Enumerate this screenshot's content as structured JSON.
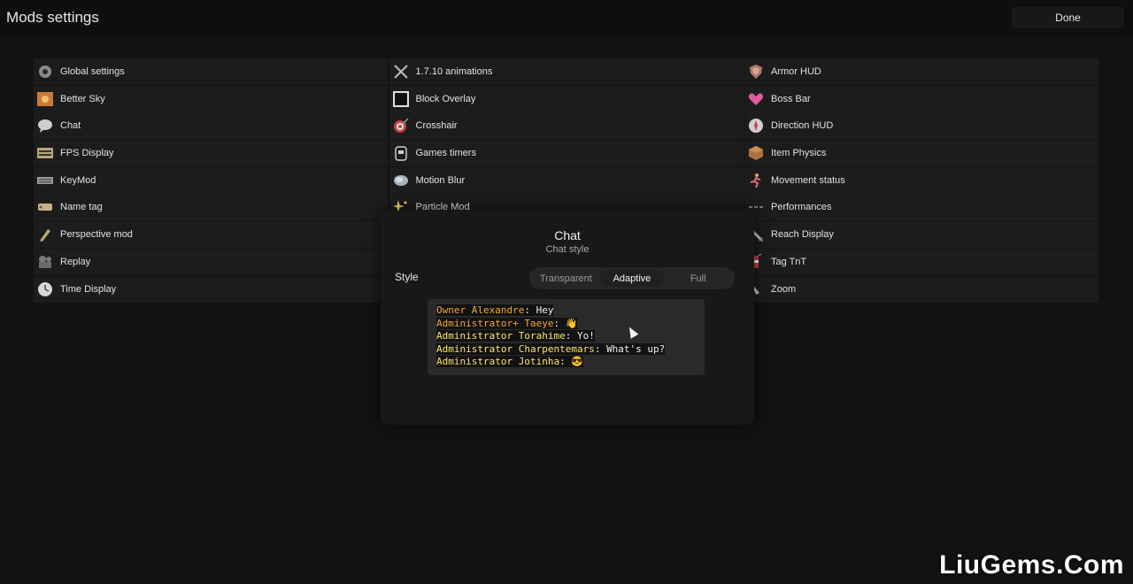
{
  "header": {
    "title": "Mods settings",
    "done_label": "Done"
  },
  "columns": [
    [
      {
        "label": "Global settings",
        "icon": "gear-icon"
      },
      {
        "label": "Better Sky",
        "icon": "sky-icon"
      },
      {
        "label": "Chat",
        "icon": "chat-bubble-icon"
      },
      {
        "label": "FPS Display",
        "icon": "fps-icon"
      },
      {
        "label": "KeyMod",
        "icon": "keyboard-icon"
      },
      {
        "label": "Name tag",
        "icon": "name-tag-icon"
      },
      {
        "label": "Perspective mod",
        "icon": "perspective-icon"
      },
      {
        "label": "Replay",
        "icon": "camera-icon"
      },
      {
        "label": "Time Display",
        "icon": "clock-icon"
      }
    ],
    [
      {
        "label": "1.7.10 animations",
        "icon": "crossed-swords-icon"
      },
      {
        "label": "Block Overlay",
        "icon": "block-outline-icon"
      },
      {
        "label": "Crosshair",
        "icon": "target-icon"
      },
      {
        "label": "Games timers",
        "icon": "timer-icon"
      },
      {
        "label": "Motion Blur",
        "icon": "blur-icon"
      },
      {
        "label": "Particle Mod",
        "icon": "sparkle-icon"
      }
    ],
    [
      {
        "label": "Armor HUD",
        "icon": "shield-icon"
      },
      {
        "label": "Boss Bar",
        "icon": "heart-icon"
      },
      {
        "label": "Direction HUD",
        "icon": "compass-icon"
      },
      {
        "label": "Item Physics",
        "icon": "box-icon"
      },
      {
        "label": "Movement status",
        "icon": "running-icon"
      },
      {
        "label": "Performances",
        "icon": "performance-icon"
      },
      {
        "label": "Reach Display",
        "icon": "reach-icon"
      },
      {
        "label": "Tag TnT",
        "icon": "tnt-icon"
      },
      {
        "label": "Zoom",
        "icon": "zoom-icon"
      }
    ]
  ],
  "modal": {
    "title": "Chat",
    "subtitle": "Chat style",
    "style_label": "Style",
    "options": [
      "Transparent",
      "Adaptive",
      "Full"
    ],
    "selected": "Adaptive",
    "preview": [
      {
        "rank": "Owner Alexandre",
        "message": "Hey",
        "rank_color": "#f5a43a"
      },
      {
        "rank": "Administrator+ Taeye",
        "message": "👋",
        "rank_color": "#f5a43a"
      },
      {
        "rank": "Administrator Torahime",
        "message": "Yo!",
        "rank_color": "#ffe26b"
      },
      {
        "rank": "Administrator Charpentemars",
        "message": "What's up?",
        "rank_color": "#ffe26b"
      },
      {
        "rank": "Administrator Jotinha",
        "message": "😎",
        "rank_color": "#ffe26b"
      }
    ]
  },
  "watermark": "LiuGems.Com",
  "colors": {
    "background": "#121212",
    "row": "#1c1c1c",
    "modal": "#181818"
  }
}
